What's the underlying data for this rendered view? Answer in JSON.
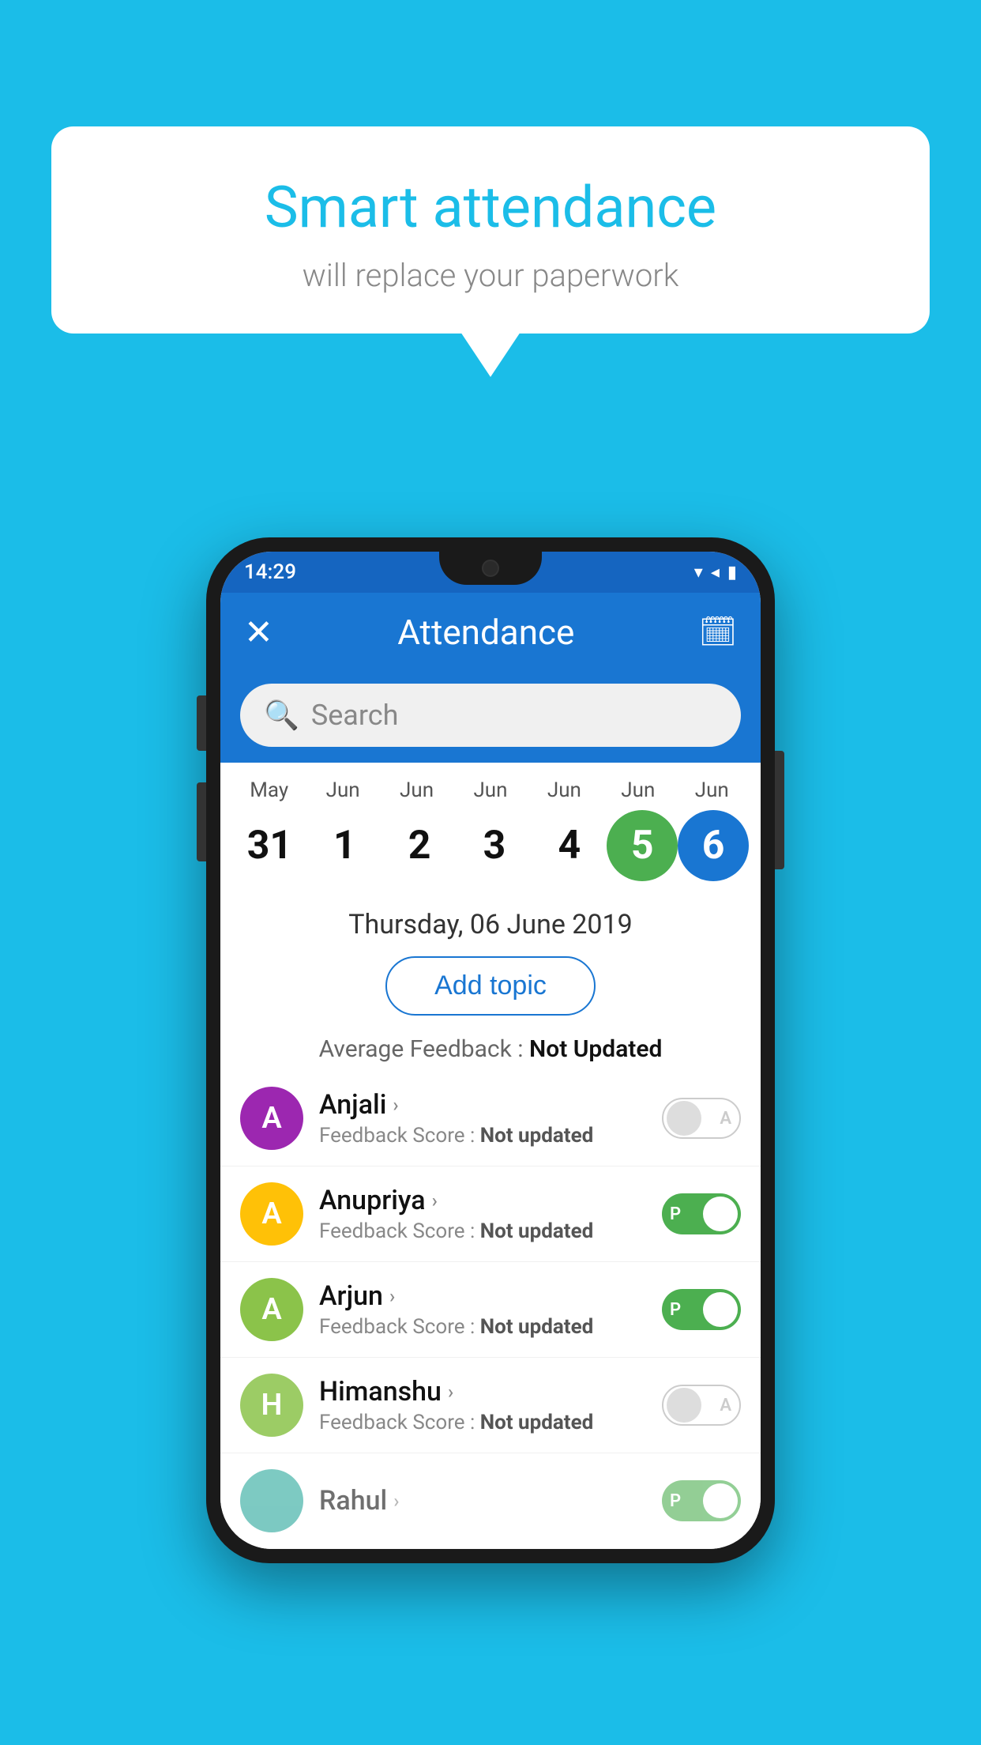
{
  "background_color": "#1BBDE8",
  "bubble": {
    "title": "Smart attendance",
    "subtitle": "will replace your paperwork"
  },
  "status_bar": {
    "time": "14:29",
    "wifi_icon": "▼",
    "signal_icon": "▲",
    "battery_icon": "▮"
  },
  "app_bar": {
    "close_icon": "✕",
    "title": "Attendance",
    "calendar_icon": "📅"
  },
  "search": {
    "placeholder": "Search"
  },
  "calendar": {
    "months": [
      "May",
      "Jun",
      "Jun",
      "Jun",
      "Jun",
      "Jun",
      "Jun"
    ],
    "dates": [
      "31",
      "1",
      "2",
      "3",
      "4",
      "5",
      "6"
    ],
    "selected_index": 5,
    "today_index": 6
  },
  "selected_date_label": "Thursday, 06 June 2019",
  "add_topic_label": "Add topic",
  "average_feedback": {
    "label": "Average Feedback : ",
    "value": "Not Updated"
  },
  "students": [
    {
      "name": "Anjali",
      "avatar_letter": "A",
      "avatar_color": "#9C27B0",
      "feedback_label": "Feedback Score : ",
      "feedback_value": "Not updated",
      "toggle_state": "off",
      "toggle_letter": "A"
    },
    {
      "name": "Anupriya",
      "avatar_letter": "A",
      "avatar_color": "#FFC107",
      "feedback_label": "Feedback Score : ",
      "feedback_value": "Not updated",
      "toggle_state": "on",
      "toggle_letter": "P"
    },
    {
      "name": "Arjun",
      "avatar_letter": "A",
      "avatar_color": "#8BC34A",
      "feedback_label": "Feedback Score : ",
      "feedback_value": "Not updated",
      "toggle_state": "on",
      "toggle_letter": "P"
    },
    {
      "name": "Himanshu",
      "avatar_letter": "H",
      "avatar_color": "#9CCC65",
      "feedback_label": "Feedback Score : ",
      "feedback_value": "Not updated",
      "toggle_state": "off",
      "toggle_letter": "A"
    }
  ]
}
